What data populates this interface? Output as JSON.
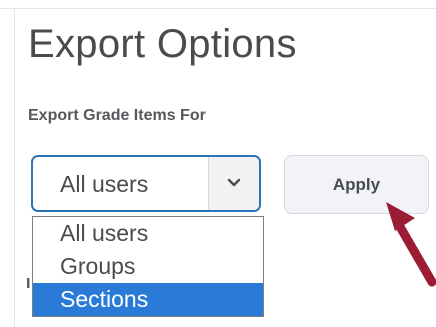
{
  "page": {
    "title": "Export Options"
  },
  "export_grade_items": {
    "label": "Export Grade Items For",
    "selected_value": "All users",
    "options": [
      "All users",
      "Groups",
      "Sections"
    ],
    "highlighted_option": "Sections"
  },
  "apply_button": {
    "label": "Apply"
  },
  "next_field": {
    "partial_label": "I"
  },
  "icons": {
    "select_arrow": "chevron-down-icon",
    "annotation": "pointer-arrow-icon"
  },
  "colors": {
    "title_text": "#494c4e",
    "focus_border": "#2a74ba",
    "highlight": "#2a7ad8",
    "annotation_arrow": "#9b1c33"
  }
}
